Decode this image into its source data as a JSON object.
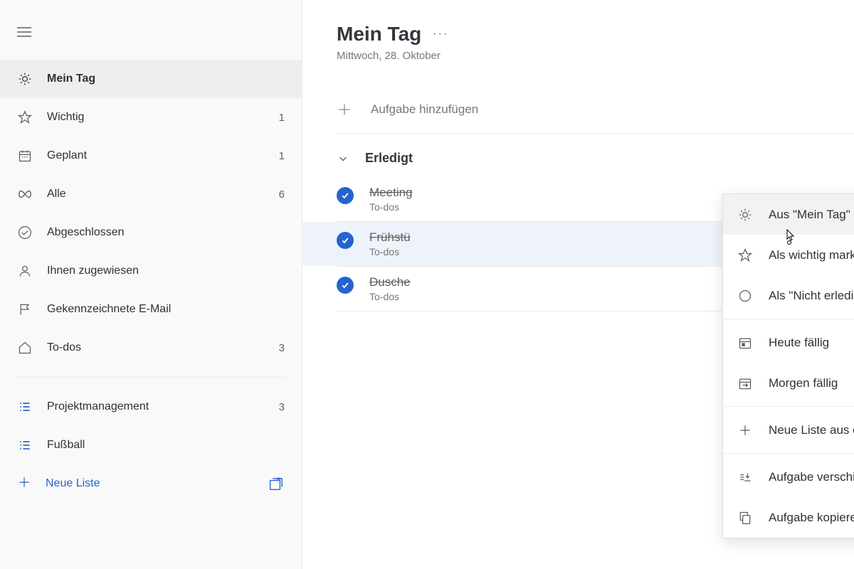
{
  "sidebar": {
    "items": [
      {
        "label": "Mein Tag",
        "count": "",
        "active": true,
        "icon": "sun"
      },
      {
        "label": "Wichtig",
        "count": "1",
        "active": false,
        "icon": "star"
      },
      {
        "label": "Geplant",
        "count": "1",
        "active": false,
        "icon": "calendar"
      },
      {
        "label": "Alle",
        "count": "6",
        "active": false,
        "icon": "infinity"
      },
      {
        "label": "Abgeschlossen",
        "count": "",
        "active": false,
        "icon": "check"
      },
      {
        "label": "Ihnen zugewiesen",
        "count": "",
        "active": false,
        "icon": "person"
      },
      {
        "label": "Gekennzeichnete E-Mail",
        "count": "",
        "active": false,
        "icon": "flag"
      },
      {
        "label": "To-dos",
        "count": "3",
        "active": false,
        "icon": "home"
      }
    ],
    "custom_lists": [
      {
        "label": "Projektmanagement",
        "count": "3"
      },
      {
        "label": "Fußball",
        "count": ""
      }
    ],
    "new_list": "Neue Liste"
  },
  "header": {
    "title": "Mein Tag",
    "date": "Mittwoch, 28. Oktober"
  },
  "add_task_placeholder": "Aufgabe hinzufügen",
  "completed_section": "Erledigt",
  "tasks": [
    {
      "title": "Meeting",
      "sub": "To-dos",
      "selected": false
    },
    {
      "title": "Frühstü",
      "sub": "To-dos",
      "selected": true
    },
    {
      "title": "Dusche",
      "sub": "To-dos",
      "selected": false
    }
  ],
  "context_menu": {
    "items": [
      {
        "label": "Aus \"Mein Tag\" entfernen",
        "icon": "sun-remove",
        "hover": true
      },
      {
        "label": "Als wichtig markieren",
        "icon": "star"
      },
      {
        "label": "Als \"Nicht erledigt\" markieren",
        "icon": "circle"
      },
      {
        "divider": true
      },
      {
        "label": "Heute fällig",
        "icon": "calendar-today"
      },
      {
        "label": "Morgen fällig",
        "icon": "calendar-arrow"
      },
      {
        "divider": true
      },
      {
        "label": "Neue Liste aus dieser Aufgabe erste…",
        "icon": "plus"
      },
      {
        "divider": true
      },
      {
        "label": "Aufgabe verschieben in…",
        "icon": "move",
        "arrow": true
      },
      {
        "label": "Aufgabe kopieren in…",
        "icon": "copy",
        "arrow": true
      }
    ]
  }
}
